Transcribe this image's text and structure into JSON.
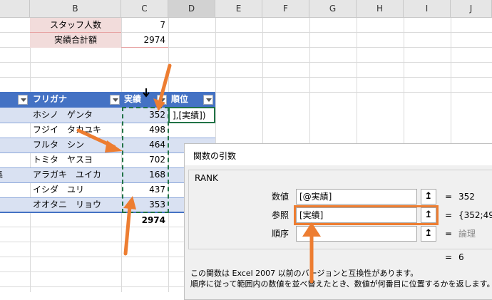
{
  "columns": [
    "B",
    "C",
    "D",
    "E",
    "F",
    "G",
    "H",
    "I",
    "J"
  ],
  "summary": [
    {
      "label": "スタッフ人数",
      "value": "7"
    },
    {
      "label": "実績合計額",
      "value": "2974"
    }
  ],
  "table": {
    "headers": [
      "フリガナ",
      "実績",
      "順位"
    ],
    "rows": [
      {
        "name": "ホシノ　ゲンタ",
        "value": "352"
      },
      {
        "name": "フジイ　タカユキ",
        "value": "498"
      },
      {
        "name": "フルタ　シン",
        "value": "464"
      },
      {
        "name": "トミタ　ヤスヨ",
        "value": "702"
      },
      {
        "name": "アラガキ　ユイカ",
        "value": "168"
      },
      {
        "name": "イシダ　ユリ",
        "value": "437"
      },
      {
        "name": "オオタニ　リョウ",
        "value": "353"
      }
    ],
    "left_edge_char": "集",
    "total": "2974",
    "editing_formula": "],[実績])"
  },
  "dialog": {
    "title": "関数の引数",
    "function_name": "RANK",
    "args": [
      {
        "label": "数値",
        "value": "[@実績]",
        "result": "352"
      },
      {
        "label": "参照",
        "value": "[実績]",
        "result": "{352;49"
      },
      {
        "label": "順序",
        "value": "",
        "result": "論理"
      }
    ],
    "equals": "=",
    "picker_icon": "↥",
    "formula_result": "6",
    "desc_line1": "この関数は Excel 2007 以前のバージョンと互換性があります。",
    "desc_line2": "順序に従って範囲内の数値を並べ替えたとき、数値が何番目に位置するかを返します。"
  },
  "colors": {
    "annotation": "#ed7d31",
    "table_header": "#4472c4",
    "band": "#d9e1f2",
    "marquee": "#217346"
  },
  "cursor_icon": "move-cursor-icon"
}
